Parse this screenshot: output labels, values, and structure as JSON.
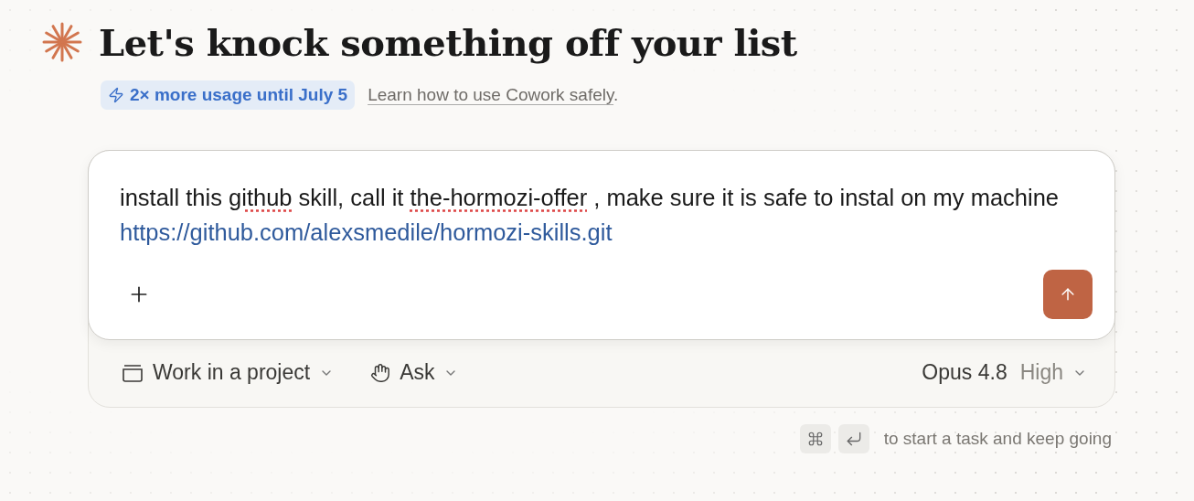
{
  "title": "Let's knock something off your list",
  "promo": {
    "badge": "2× more usage until July 5",
    "link": "Learn how to use Cowork safely",
    "suffix": "."
  },
  "prompt": {
    "segments": [
      {
        "kind": "text",
        "text": "install this "
      },
      {
        "kind": "misspelled",
        "text": "github"
      },
      {
        "kind": "text",
        "text": " skill, call it "
      },
      {
        "kind": "misspelled",
        "text": "the-hormozi-offer"
      },
      {
        "kind": "text",
        "text": " , make sure it is safe to instal on my machine "
      },
      {
        "kind": "link",
        "text": "https://github.com/alexsmedile/hormozi-skills.git"
      }
    ]
  },
  "toolbar": {
    "project": "Work in a project",
    "mode": "Ask",
    "model": "Opus 4.8",
    "effort": "High"
  },
  "hint": "to start a task and keep going"
}
